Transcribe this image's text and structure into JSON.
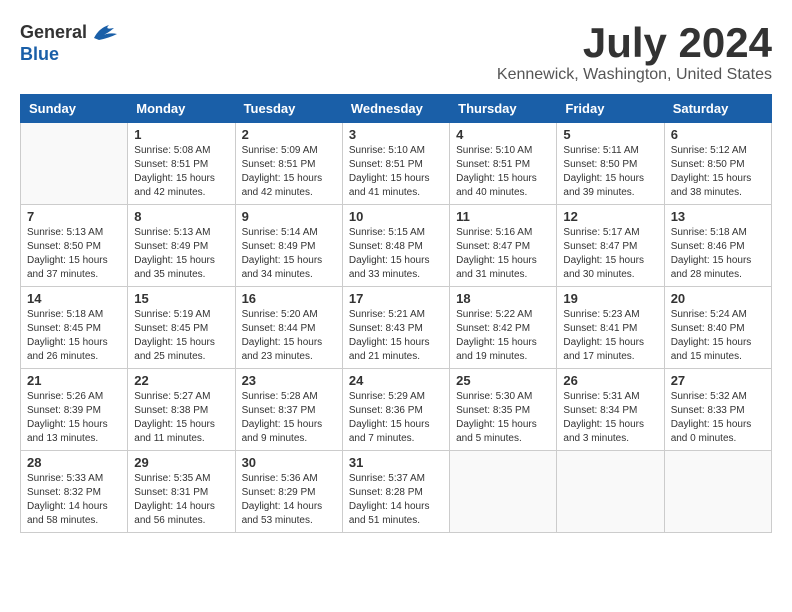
{
  "logo": {
    "general": "General",
    "blue": "Blue"
  },
  "title": "July 2024",
  "location": "Kennewick, Washington, United States",
  "days_of_week": [
    "Sunday",
    "Monday",
    "Tuesday",
    "Wednesday",
    "Thursday",
    "Friday",
    "Saturday"
  ],
  "weeks": [
    [
      {
        "day": "",
        "sunrise": "",
        "sunset": "",
        "daylight": ""
      },
      {
        "day": "1",
        "sunrise": "Sunrise: 5:08 AM",
        "sunset": "Sunset: 8:51 PM",
        "daylight": "Daylight: 15 hours and 42 minutes."
      },
      {
        "day": "2",
        "sunrise": "Sunrise: 5:09 AM",
        "sunset": "Sunset: 8:51 PM",
        "daylight": "Daylight: 15 hours and 42 minutes."
      },
      {
        "day": "3",
        "sunrise": "Sunrise: 5:10 AM",
        "sunset": "Sunset: 8:51 PM",
        "daylight": "Daylight: 15 hours and 41 minutes."
      },
      {
        "day": "4",
        "sunrise": "Sunrise: 5:10 AM",
        "sunset": "Sunset: 8:51 PM",
        "daylight": "Daylight: 15 hours and 40 minutes."
      },
      {
        "day": "5",
        "sunrise": "Sunrise: 5:11 AM",
        "sunset": "Sunset: 8:50 PM",
        "daylight": "Daylight: 15 hours and 39 minutes."
      },
      {
        "day": "6",
        "sunrise": "Sunrise: 5:12 AM",
        "sunset": "Sunset: 8:50 PM",
        "daylight": "Daylight: 15 hours and 38 minutes."
      }
    ],
    [
      {
        "day": "7",
        "sunrise": "Sunrise: 5:13 AM",
        "sunset": "Sunset: 8:50 PM",
        "daylight": "Daylight: 15 hours and 37 minutes."
      },
      {
        "day": "8",
        "sunrise": "Sunrise: 5:13 AM",
        "sunset": "Sunset: 8:49 PM",
        "daylight": "Daylight: 15 hours and 35 minutes."
      },
      {
        "day": "9",
        "sunrise": "Sunrise: 5:14 AM",
        "sunset": "Sunset: 8:49 PM",
        "daylight": "Daylight: 15 hours and 34 minutes."
      },
      {
        "day": "10",
        "sunrise": "Sunrise: 5:15 AM",
        "sunset": "Sunset: 8:48 PM",
        "daylight": "Daylight: 15 hours and 33 minutes."
      },
      {
        "day": "11",
        "sunrise": "Sunrise: 5:16 AM",
        "sunset": "Sunset: 8:47 PM",
        "daylight": "Daylight: 15 hours and 31 minutes."
      },
      {
        "day": "12",
        "sunrise": "Sunrise: 5:17 AM",
        "sunset": "Sunset: 8:47 PM",
        "daylight": "Daylight: 15 hours and 30 minutes."
      },
      {
        "day": "13",
        "sunrise": "Sunrise: 5:18 AM",
        "sunset": "Sunset: 8:46 PM",
        "daylight": "Daylight: 15 hours and 28 minutes."
      }
    ],
    [
      {
        "day": "14",
        "sunrise": "Sunrise: 5:18 AM",
        "sunset": "Sunset: 8:45 PM",
        "daylight": "Daylight: 15 hours and 26 minutes."
      },
      {
        "day": "15",
        "sunrise": "Sunrise: 5:19 AM",
        "sunset": "Sunset: 8:45 PM",
        "daylight": "Daylight: 15 hours and 25 minutes."
      },
      {
        "day": "16",
        "sunrise": "Sunrise: 5:20 AM",
        "sunset": "Sunset: 8:44 PM",
        "daylight": "Daylight: 15 hours and 23 minutes."
      },
      {
        "day": "17",
        "sunrise": "Sunrise: 5:21 AM",
        "sunset": "Sunset: 8:43 PM",
        "daylight": "Daylight: 15 hours and 21 minutes."
      },
      {
        "day": "18",
        "sunrise": "Sunrise: 5:22 AM",
        "sunset": "Sunset: 8:42 PM",
        "daylight": "Daylight: 15 hours and 19 minutes."
      },
      {
        "day": "19",
        "sunrise": "Sunrise: 5:23 AM",
        "sunset": "Sunset: 8:41 PM",
        "daylight": "Daylight: 15 hours and 17 minutes."
      },
      {
        "day": "20",
        "sunrise": "Sunrise: 5:24 AM",
        "sunset": "Sunset: 8:40 PM",
        "daylight": "Daylight: 15 hours and 15 minutes."
      }
    ],
    [
      {
        "day": "21",
        "sunrise": "Sunrise: 5:26 AM",
        "sunset": "Sunset: 8:39 PM",
        "daylight": "Daylight: 15 hours and 13 minutes."
      },
      {
        "day": "22",
        "sunrise": "Sunrise: 5:27 AM",
        "sunset": "Sunset: 8:38 PM",
        "daylight": "Daylight: 15 hours and 11 minutes."
      },
      {
        "day": "23",
        "sunrise": "Sunrise: 5:28 AM",
        "sunset": "Sunset: 8:37 PM",
        "daylight": "Daylight: 15 hours and 9 minutes."
      },
      {
        "day": "24",
        "sunrise": "Sunrise: 5:29 AM",
        "sunset": "Sunset: 8:36 PM",
        "daylight": "Daylight: 15 hours and 7 minutes."
      },
      {
        "day": "25",
        "sunrise": "Sunrise: 5:30 AM",
        "sunset": "Sunset: 8:35 PM",
        "daylight": "Daylight: 15 hours and 5 minutes."
      },
      {
        "day": "26",
        "sunrise": "Sunrise: 5:31 AM",
        "sunset": "Sunset: 8:34 PM",
        "daylight": "Daylight: 15 hours and 3 minutes."
      },
      {
        "day": "27",
        "sunrise": "Sunrise: 5:32 AM",
        "sunset": "Sunset: 8:33 PM",
        "daylight": "Daylight: 15 hours and 0 minutes."
      }
    ],
    [
      {
        "day": "28",
        "sunrise": "Sunrise: 5:33 AM",
        "sunset": "Sunset: 8:32 PM",
        "daylight": "Daylight: 14 hours and 58 minutes."
      },
      {
        "day": "29",
        "sunrise": "Sunrise: 5:35 AM",
        "sunset": "Sunset: 8:31 PM",
        "daylight": "Daylight: 14 hours and 56 minutes."
      },
      {
        "day": "30",
        "sunrise": "Sunrise: 5:36 AM",
        "sunset": "Sunset: 8:29 PM",
        "daylight": "Daylight: 14 hours and 53 minutes."
      },
      {
        "day": "31",
        "sunrise": "Sunrise: 5:37 AM",
        "sunset": "Sunset: 8:28 PM",
        "daylight": "Daylight: 14 hours and 51 minutes."
      },
      {
        "day": "",
        "sunrise": "",
        "sunset": "",
        "daylight": ""
      },
      {
        "day": "",
        "sunrise": "",
        "sunset": "",
        "daylight": ""
      },
      {
        "day": "",
        "sunrise": "",
        "sunset": "",
        "daylight": ""
      }
    ]
  ]
}
